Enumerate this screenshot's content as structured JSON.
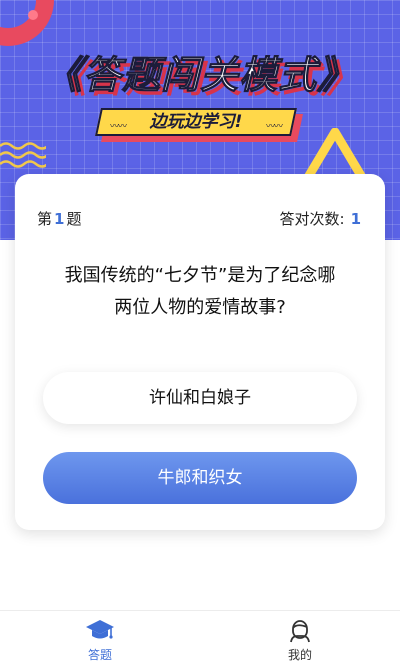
{
  "hero": {
    "title": "《答题闯关模式》",
    "subtitle": "边玩边学习!"
  },
  "quiz": {
    "question_prefix": "第",
    "question_number": "1",
    "question_suffix": "题",
    "correct_label": "答对次数:",
    "correct_count": "1",
    "question_line1": "我国传统的“七夕节”是为了纪念哪",
    "question_line2": "两位人物的爱情故事?",
    "options": [
      {
        "label": "许仙和白娘子"
      },
      {
        "label": "牛郎和织女"
      }
    ]
  },
  "tabbar": {
    "tabs": [
      {
        "label": "答题",
        "icon": "graduation-cap-icon",
        "active": true
      },
      {
        "label": "我的",
        "icon": "user-icon",
        "active": false
      }
    ]
  },
  "colors": {
    "hero_bg": "#5b63e6",
    "accent_red": "#e84a5f",
    "banner_yellow": "#ffd84a",
    "primary_blue": "#3f6fd6"
  }
}
